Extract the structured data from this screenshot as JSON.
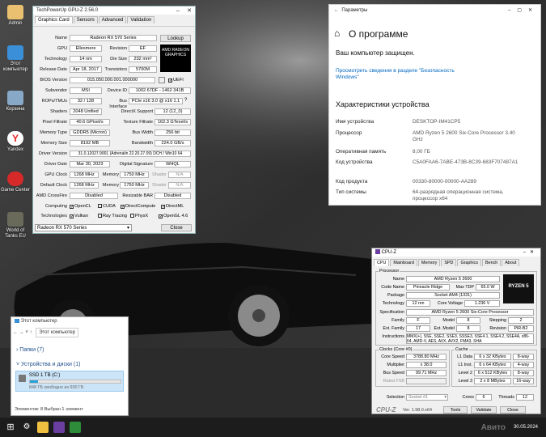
{
  "desktop": {
    "icons": [
      {
        "label": "Admin",
        "color": "#e8c070"
      },
      {
        "label": "Этот компьютер",
        "color": "#3a8fd8"
      },
      {
        "label": "Корзина",
        "color": "#88a8c8"
      },
      {
        "label": "Yandex",
        "color": "#ffcc00"
      },
      {
        "label": "Game Center",
        "color": "#d62a2a"
      },
      {
        "label": "World of Tanks EU",
        "color": "#6a6a5a"
      }
    ]
  },
  "gpuz": {
    "title": "TechPowerUp GPU-Z 2.56.0",
    "tabs": [
      "Graphics Card",
      "Sensors",
      "Advanced",
      "Validation"
    ],
    "lookup": "Lookup",
    "rows": {
      "name_l": "Name",
      "name_v": "Radeon RX 570 Series",
      "gpu_l": "GPU",
      "gpu_v": "Ellesmere",
      "rev_l": "Revision",
      "rev_v": "EF",
      "tech_l": "Technology",
      "tech_v": "14 nm",
      "die_l": "Die Size",
      "die_v": "232 mm²",
      "rel_l": "Release Date",
      "rel_v": "Apr 18, 2017",
      "tr_l": "Transistors",
      "tr_v": "5700M",
      "bios_l": "BIOS Version",
      "bios_v": "015.050.000.001.000000",
      "uefi": "UEFI",
      "sub_l": "Subvendor",
      "sub_v": "MSI",
      "dev_l": "Device ID",
      "dev_v": "1002 67DF - 1462 341B",
      "rop_l": "ROPs/TMUs",
      "rop_v": "32 / 128",
      "bus_l": "Bus Interface",
      "bus_v": "PCIe x16 3.0 @ x16 1.1",
      "sh_l": "Shaders",
      "sh_v": "2048 Unified",
      "dx_l": "DirectX Support",
      "dx_v": "12 (12_0)",
      "pf_l": "Pixel Fillrate",
      "pf_v": "40.6 GPixel/s",
      "tf_l": "Texture Fillrate",
      "tf_v": "162.3 GTexel/s",
      "mt_l": "Memory Type",
      "mt_v": "GDDR5 (Micron)",
      "bw_l": "Bus Width",
      "bw_v": "256 bit",
      "ms_l": "Memory Size",
      "ms_v": "8192 MB",
      "bd_l": "Bandwidth",
      "bd_v": "224.0 GB/s",
      "dv_l": "Driver Version",
      "dv_v": "31.0.12027.9001 (Adrenalin 22.20.27.09) DCH / Win10 64",
      "dd_l": "Driver Date",
      "dd_v": "Mar 30, 2023",
      "ds_l": "Digital Signature",
      "ds_v": "WHQL",
      "gc_l": "GPU Clock",
      "gc_v": "1268 MHz",
      "mem_l": "Memory",
      "gc_m": "1750 MHz",
      "shd_l": "Shader",
      "gc_s": "N/A",
      "dc_l": "Default Clock",
      "dc_v": "1268 MHz",
      "dc_m": "1750 MHz",
      "dc_s": "N/A",
      "cf_l": "AMD CrossFire",
      "cf_v": "Disabled",
      "rb_l": "Resizable BAR",
      "rb_v": "Disabled",
      "comp_l": "Computing",
      "tech2_l": "Technologies"
    },
    "computing": [
      "OpenCL",
      "CUDA",
      "DirectCompute",
      "DirectML"
    ],
    "technologies": [
      "Vulkan",
      "Ray Tracing",
      "PhysX",
      "OpenGL 4.6"
    ],
    "select": "Radeon RX 570 Series",
    "close": "Close",
    "logo": "AMD RADEON GRAPHICS"
  },
  "settings": {
    "window_title": "Параметры",
    "heading": "О программе",
    "protected": "Ваш компьютер защищен.",
    "link": "Просмотреть сведения в разделе \"Безопасность Windows\"",
    "specs_heading": "Характеристики устройства",
    "specs": [
      {
        "k": "Имя устройства",
        "v": "DESKTOP-IM41CP5"
      },
      {
        "k": "Процессор",
        "v": "AMD Ryzen 5 2600 Six-Core Processor 3.40 GHz"
      },
      {
        "k": "Оперативная память",
        "v": "8,00 ГБ"
      },
      {
        "k": "Код устройства",
        "v": "C5A0FAA6-7ABE-473B-8C39-683F707487A1"
      },
      {
        "k": "Код продукта",
        "v": "00330-80000-00000-AA289"
      },
      {
        "k": "Тип системы",
        "v": "64-разрядная операционная система, процессор x64"
      }
    ]
  },
  "cpuz": {
    "title": "CPU-Z",
    "tabs": [
      "CPU",
      "Mainboard",
      "Memory",
      "SPD",
      "Graphics",
      "Bench",
      "About"
    ],
    "proc_group": "Processor",
    "name_l": "Name",
    "name_v": "AMD Ryzen 5 2600",
    "code_l": "Code Name",
    "code_v": "Pinnacle Ridge",
    "tdp_l": "Max TDP",
    "tdp_v": "65.0 W",
    "pkg_l": "Package",
    "pkg_v": "Socket AM4 (1331)",
    "tech_l": "Technology",
    "tech_v": "12 nm",
    "cv_l": "Core Voltage",
    "cv_v": "1.236 V",
    "spec_l": "Specification",
    "spec_v": "AMD Ryzen 5 2600 Six-Core Processor",
    "fam_l": "Family",
    "fam_v": "F",
    "mod_l": "Model",
    "mod_v": "8",
    "step_l": "Stepping",
    "step_v": "2",
    "efam_l": "Ext. Family",
    "efam_v": "17",
    "emod_l": "Ext. Model",
    "emod_v": "8",
    "rev_l": "Revision",
    "rev_v": "PiR-B2",
    "ins_l": "Instructions",
    "ins_v": "MMX(+), SSE, SSE2, SSE3, SSSE3, SSE4.1, SSE4.2, SSE4A, x86-64, AMD-V, AES, AVX, AVX2, FMA3, SHA",
    "clocks_group": "Clocks (Core #0)",
    "cs_l": "Core Speed",
    "cs_v": "3788.80 MHz",
    "mul_l": "Multiplier",
    "mul_v": "x 38.0",
    "bs_l": "Bus Speed",
    "bs_v": "99.71 MHz",
    "fsb_l": "Rated FSB",
    "cache_group": "Cache",
    "cache": [
      {
        "l": "L1 Data",
        "v": "6 x 32 KBytes",
        "w": "8-way"
      },
      {
        "l": "L1 Inst.",
        "v": "6 x 64 KBytes",
        "w": "4-way"
      },
      {
        "l": "Level 2",
        "v": "6 x 512 KBytes",
        "w": "8-way"
      },
      {
        "l": "Level 3",
        "v": "2 x 8 MBytes",
        "w": "16-way"
      }
    ],
    "sel_l": "Selection",
    "sel_v": "Socket #1",
    "cores_l": "Cores",
    "cores_v": "6",
    "thr_l": "Threads",
    "thr_v": "12",
    "ver": "Ver. 1.98.0.x64",
    "tools": "Tools",
    "validate": "Validate",
    "close": "Close",
    "logo": "RYZEN 5"
  },
  "explorer": {
    "title": "Этот компьютер",
    "address": "Этот компьютер",
    "folders": "Папки (7)",
    "devices": "Устройства и диски (1)",
    "drive_name": "SSD 1 TB (C:)",
    "drive_free": "848 ГБ свободно из 930 ГБ",
    "drive_used_fraction": 0.09,
    "status": "Элементов: 8   Выбран 1 элемент"
  },
  "taskbar": {
    "date": "30.05.2024",
    "watermark": "Авито"
  }
}
